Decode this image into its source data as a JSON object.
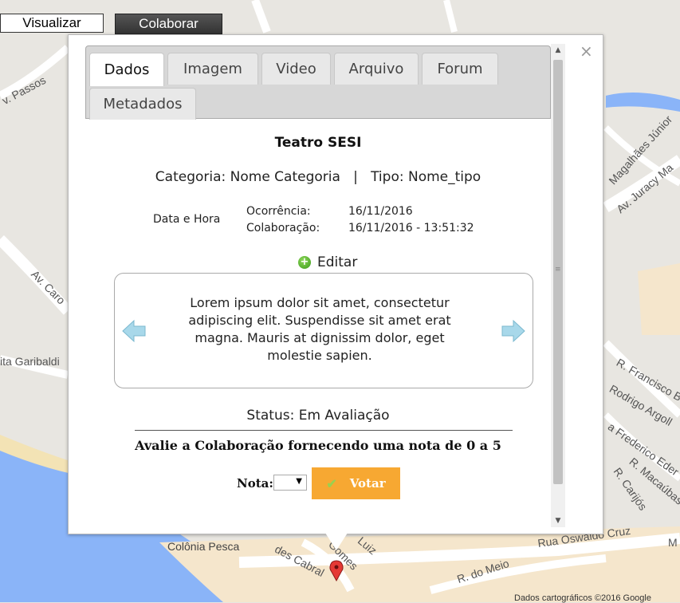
{
  "top_buttons": {
    "visualize": "Visualizar",
    "collaborate": "Colaborar"
  },
  "map": {
    "labels": {
      "passos": "v. Passos",
      "caro": "Av. Caro",
      "garibaldi": "ita Garibaldi",
      "magalhaes": "Magalhães Júnior",
      "juracy": "Av. Juracy Ma",
      "francisco": "R. Francisco Be",
      "rodrigo": "Rodrigo Argoll",
      "frederico": "a Frederico Eder",
      "macaubas": "R. Macaúbas",
      "carijos": "R. Carijós",
      "colonia": "Colônia Pesca",
      "cabral": "des Cabral",
      "gomes": "Gomes",
      "luiz": "Luiz",
      "rua_oswaldo": "Rua Oswaldo Cruz",
      "do_meio": "R. do Meio",
      "m": "M",
      "footer": "Dados cartográficos ©2016 Google"
    },
    "colors": {
      "land": "#e8e6e1",
      "water": "#8ab4f8",
      "road": "#ffffff",
      "urban": "#f5e6cc",
      "marker": "#e53935"
    }
  },
  "popup": {
    "close_symbol": "×",
    "tabs": [
      "Dados",
      "Imagem",
      "Video",
      "Arquivo",
      "Forum",
      "Metadados"
    ],
    "active_tab": "Dados",
    "title": "Teatro SESI",
    "category_line": "Categoria: Nome Categoria   |   Tipo: Nome_tipo",
    "date_label": "Data e Hora",
    "dates": [
      {
        "key": "Ocorrência:",
        "value": "16/11/2016"
      },
      {
        "key": "Colaboração:",
        "value": "16/11/2016 - 13:51:32"
      }
    ],
    "edit_label": "Editar",
    "description": "Lorem ipsum dolor sit amet, consectetur adipiscing elit. Suspendisse sit amet erat magna. Mauris at dignissim dolor, eget molestie sapien.",
    "status": "Status: Em Avaliação",
    "rate_prompt": "Avalie a Colaboração fornecendo uma nota de 0 a 5",
    "nota_label": "Nota:",
    "nota_value": "",
    "vote_label": "Votar",
    "colors": {
      "vote": "#f7a832",
      "tab_bar": "#d7d7d7"
    }
  }
}
